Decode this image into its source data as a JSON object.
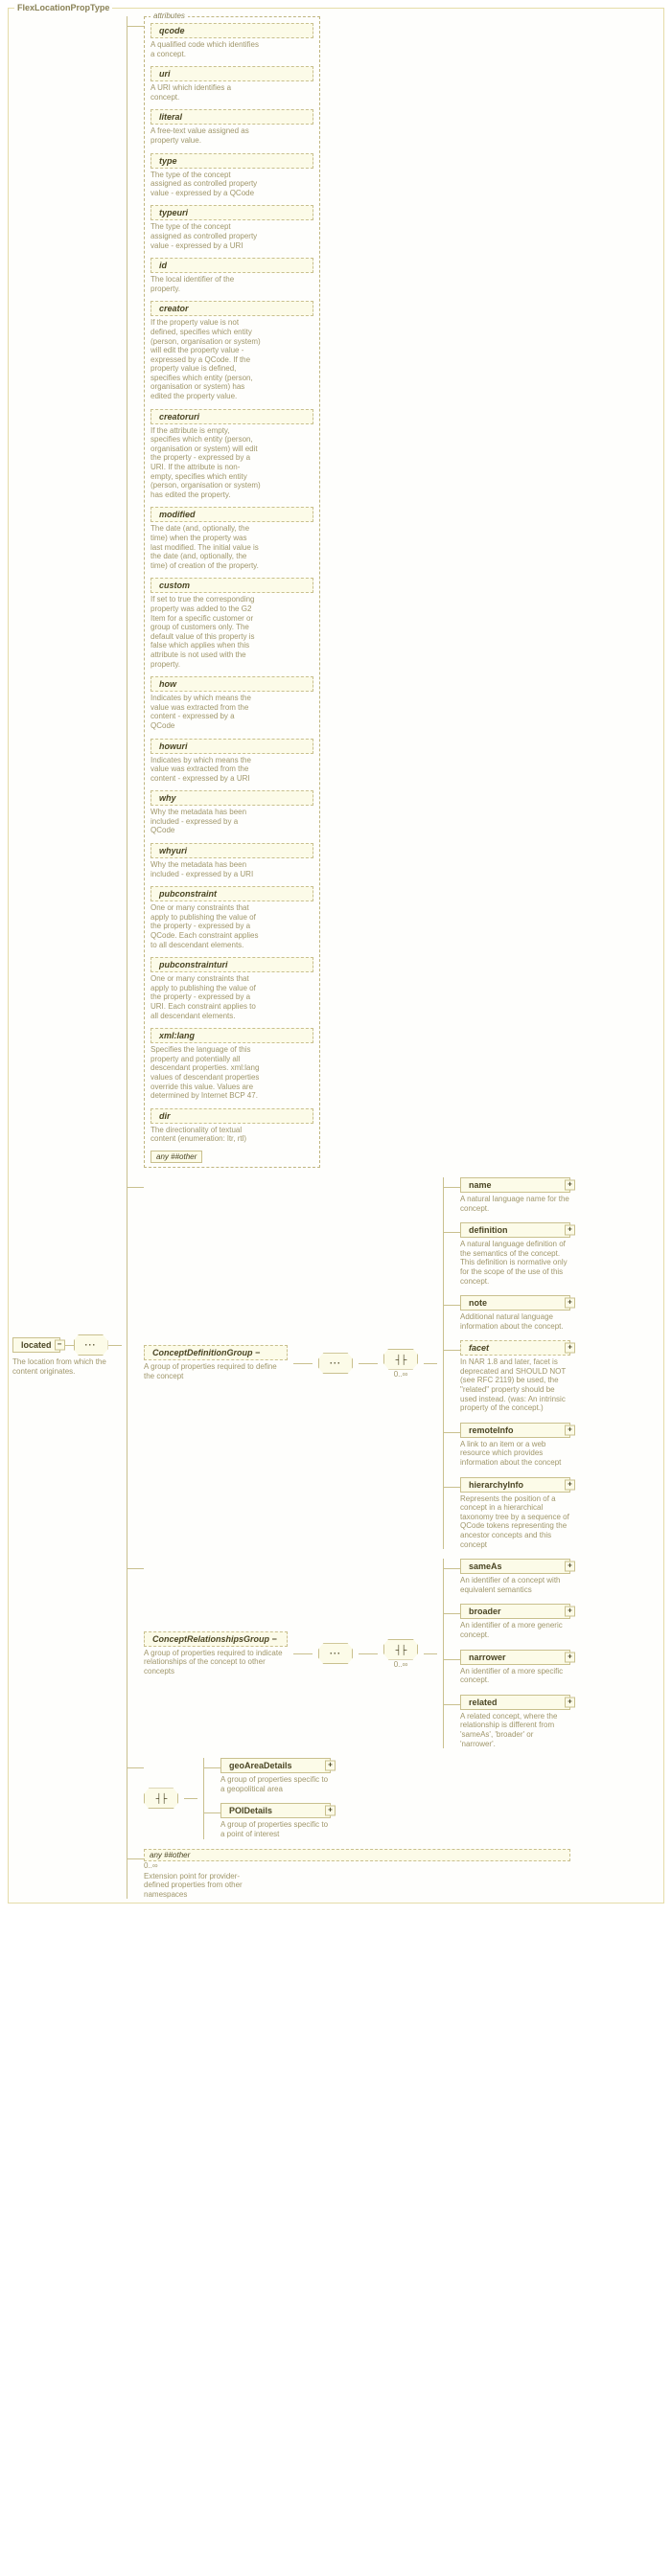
{
  "type_name": "FlexLocationPropType",
  "root": {
    "name": "located",
    "desc": "The location from which the content originates."
  },
  "attributes_label": "attributes",
  "attributes": [
    {
      "name": "qcode",
      "desc": "A qualified code which identifies a concept."
    },
    {
      "name": "uri",
      "desc": "A URI which identifies a concept."
    },
    {
      "name": "literal",
      "desc": "A free-text value assigned as property value."
    },
    {
      "name": "type",
      "desc": "The type of the concept assigned as controlled property value - expressed by a QCode"
    },
    {
      "name": "typeuri",
      "desc": "The type of the concept assigned as controlled property value - expressed by a URI"
    },
    {
      "name": "id",
      "desc": "The local identifier of the property."
    },
    {
      "name": "creator",
      "desc": "If the property value is not defined, specifies which entity (person, organisation or system) will edit the property value - expressed by a QCode. If the property value is defined, specifies which entity (person, organisation or system) has edited the property value."
    },
    {
      "name": "creatoruri",
      "desc": "If the attribute is empty, specifies which entity (person, organisation or system) will edit the property - expressed by a URI. If the attribute is non-empty, specifies which entity (person, organisation or system) has edited the property."
    },
    {
      "name": "modified",
      "desc": "The date (and, optionally, the time) when the property was last modified. The initial value is the date (and, optionally, the time) of creation of the property."
    },
    {
      "name": "custom",
      "desc": "If set to true the corresponding property was added to the G2 Item for a specific customer or group of customers only. The default value of this property is false which applies when this attribute is not used with the property."
    },
    {
      "name": "how",
      "desc": "Indicates by which means the value was extracted from the content - expressed by a QCode"
    },
    {
      "name": "howuri",
      "desc": "Indicates by which means the value was extracted from the content - expressed by a URI"
    },
    {
      "name": "why",
      "desc": "Why the metadata has been included - expressed by a QCode"
    },
    {
      "name": "whyuri",
      "desc": "Why the metadata has been included - expressed by a URI"
    },
    {
      "name": "pubconstraint",
      "desc": "One or many constraints that apply to publishing the value of the property - expressed by a QCode. Each constraint applies to all descendant elements."
    },
    {
      "name": "pubconstrainturi",
      "desc": "One or many constraints that apply to publishing the value of the property - expressed by a URI. Each constraint applies to all descendant elements."
    },
    {
      "name": "xml:lang",
      "desc": "Specifies the language of this property and potentially all descendant properties. xml:lang values of descendant properties override this value. Values are determined by Internet BCP 47."
    },
    {
      "name": "dir",
      "desc": "The directionality of textual content (enumeration: ltr, rtl)"
    }
  ],
  "any_other": "any ##other",
  "groups": {
    "cdg": {
      "name": "ConceptDefinitionGroup",
      "desc": "A group of properties required to define the concept",
      "mult": "0..∞",
      "children": [
        {
          "name": "name",
          "desc": "A natural language name for the concept."
        },
        {
          "name": "definition",
          "desc": "A natural language definition of the semantics of the concept. This definition is normative only for the scope of the use of this concept."
        },
        {
          "name": "note",
          "desc": "Additional natural language information about the concept."
        },
        {
          "name": "facet",
          "desc": "In NAR 1.8 and later, facet is deprecated and SHOULD NOT (see RFC 2119) be used, the \"related\" property should be used instead. (was: An intrinsic property of the concept.)"
        },
        {
          "name": "remoteInfo",
          "desc": "A link to an item or a web resource which provides information about the concept"
        },
        {
          "name": "hierarchyInfo",
          "desc": "Represents the position of a concept in a hierarchical taxonomy tree by a sequence of QCode tokens representing the ancestor concepts and this concept"
        }
      ]
    },
    "crg": {
      "name": "ConceptRelationshipsGroup",
      "desc": "A group of properties required to indicate relationships of the concept to other concepts",
      "mult": "0..∞",
      "children": [
        {
          "name": "sameAs",
          "desc": "An identifier of a concept with equivalent semantics"
        },
        {
          "name": "broader",
          "desc": "An identifier of a more generic concept."
        },
        {
          "name": "narrower",
          "desc": "An identifier of a more specific concept."
        },
        {
          "name": "related",
          "desc": "A related concept, where the relationship is different from 'sameAs', 'broader' or 'narrower'."
        }
      ]
    },
    "choice": [
      {
        "name": "geoAreaDetails",
        "desc": "A group of properties specific to a geopolitical area"
      },
      {
        "name": "POIDetails",
        "desc": "A group of properties specific to a point of interest"
      }
    ],
    "any_bottom": {
      "label": "any ##other",
      "mult": "0..∞",
      "desc": "Extension point for provider-defined properties from other namespaces"
    }
  }
}
